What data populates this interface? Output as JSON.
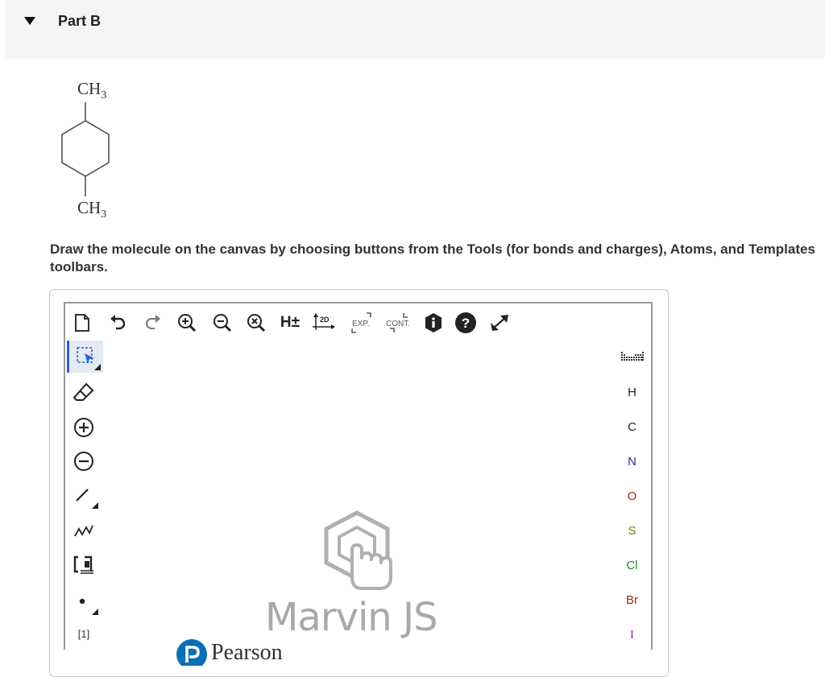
{
  "part": {
    "title": "Part B"
  },
  "molecule": {
    "top_label_main": "CH",
    "top_label_sub": "3",
    "bottom_label_main": "CH",
    "bottom_label_sub": "3"
  },
  "instructions": "Draw the molecule on the canvas by choosing buttons from the Tools (for bonds and charges), Atoms, and Templates toolbars.",
  "editor": {
    "top_toolbar": {
      "hydrogen_label": "H±",
      "clean_label": "2D",
      "expand_label": "EXP.",
      "contract_label": "CONT."
    },
    "left_toolbar": {
      "reaction_label": "[1]"
    },
    "atoms": [
      {
        "symbol": "H",
        "color": "#222222"
      },
      {
        "symbol": "C",
        "color": "#222222"
      },
      {
        "symbol": "N",
        "color": "#2a2a9c"
      },
      {
        "symbol": "O",
        "color": "#d01616"
      },
      {
        "symbol": "S",
        "color": "#8a7d10"
      },
      {
        "symbol": "Cl",
        "color": "#1f8a1f"
      },
      {
        "symbol": "Br",
        "color": "#8a2a1a"
      },
      {
        "symbol": "I",
        "color": "#7a1f9c"
      }
    ],
    "watermark": "Marvin JS"
  },
  "footer": {
    "brand": "Pearson",
    "brand_color": "#0a6fb5"
  }
}
